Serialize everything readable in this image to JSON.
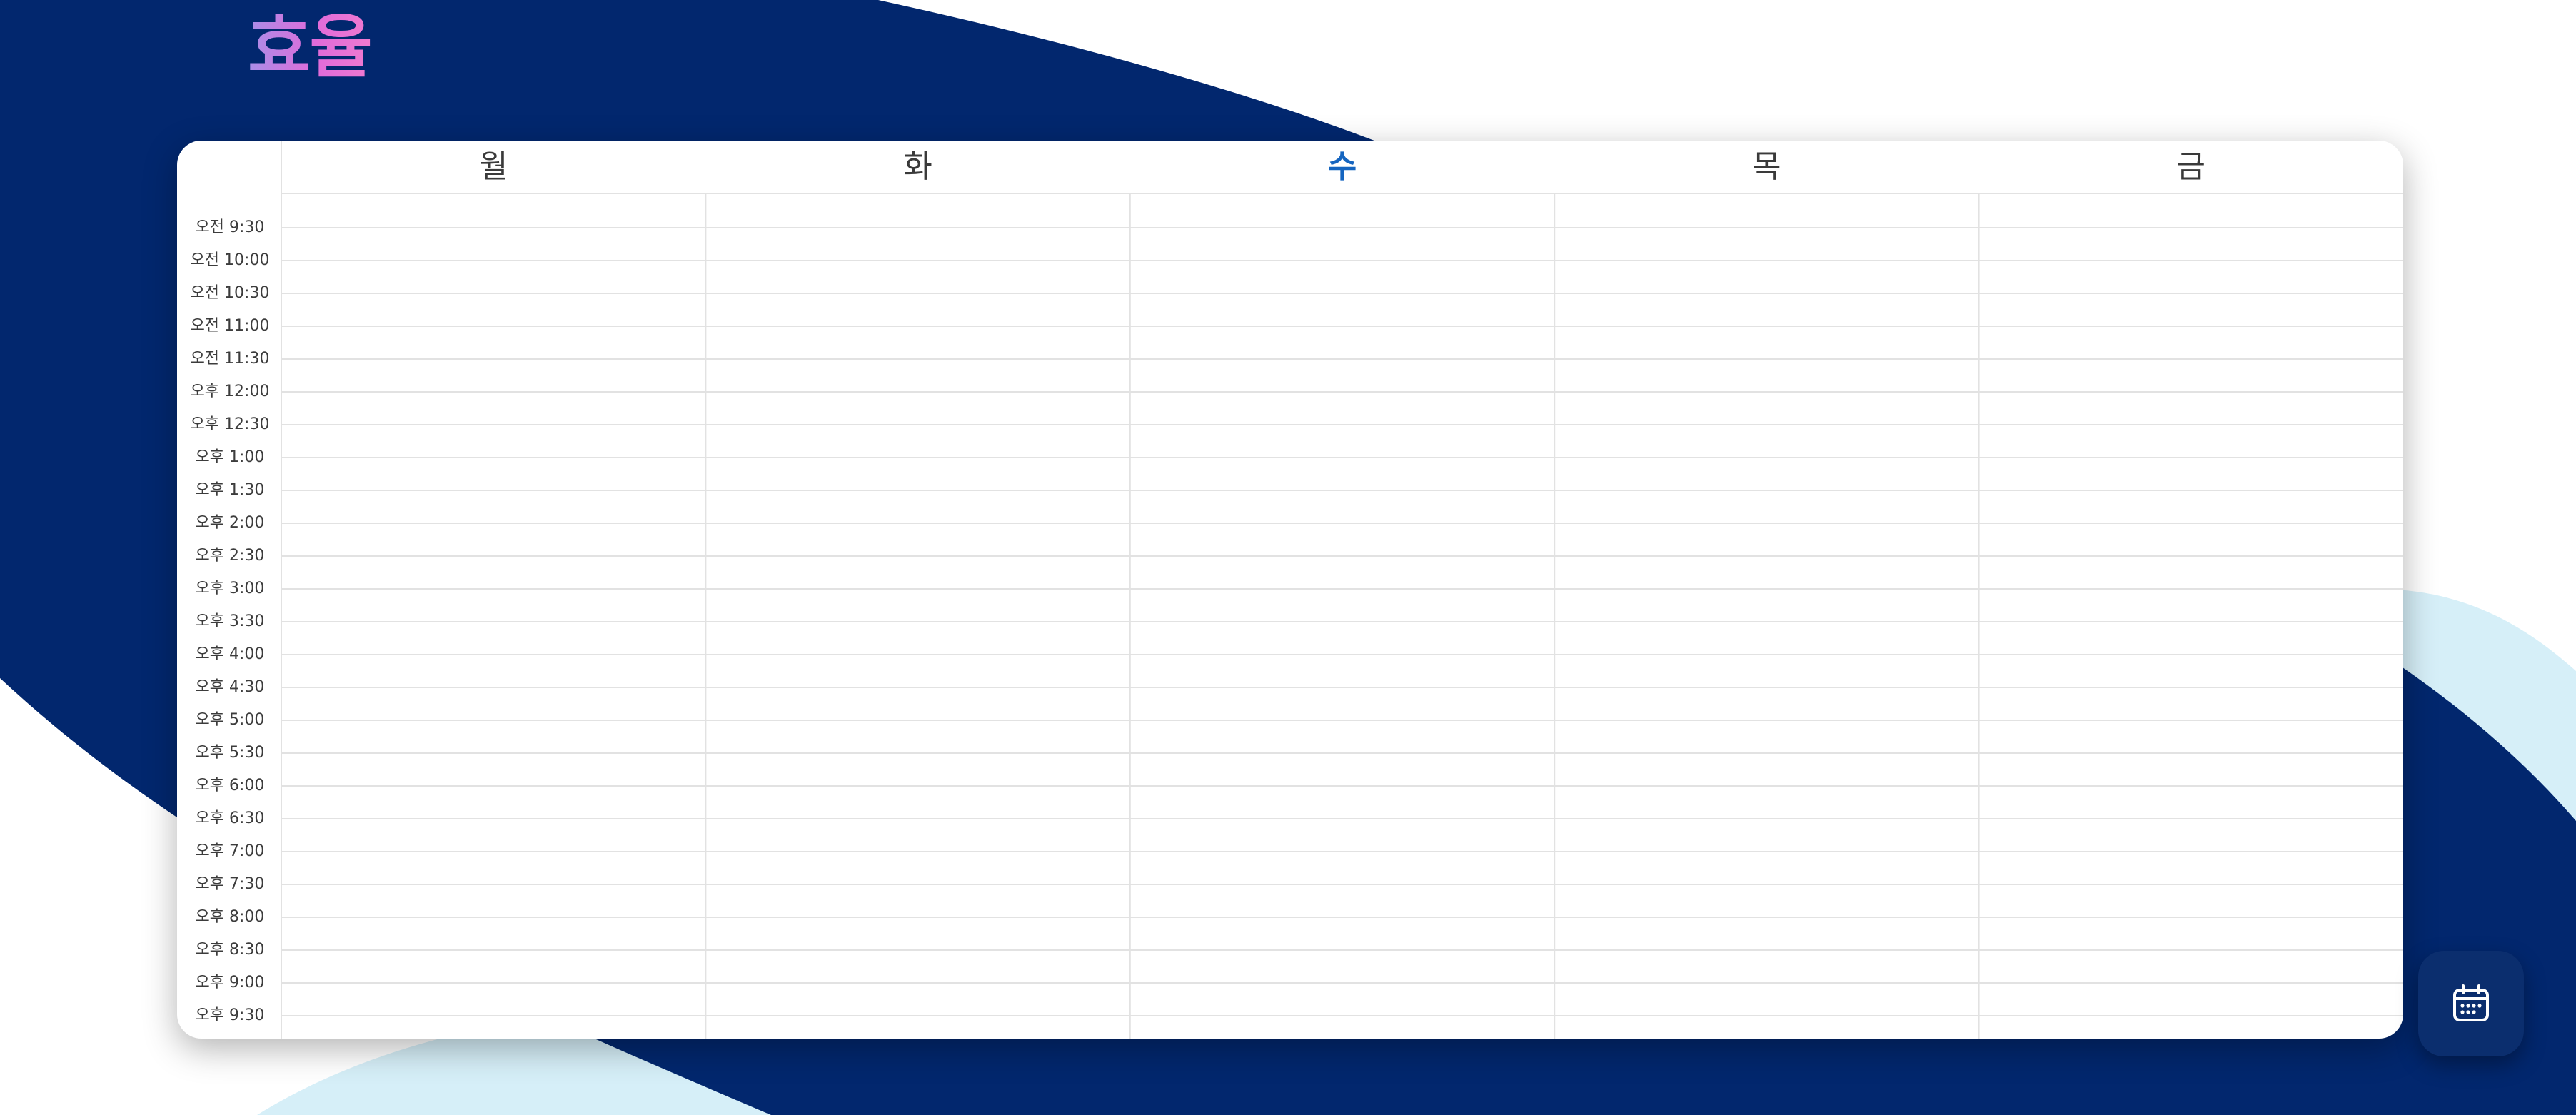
{
  "app": {
    "logo_text": "효율"
  },
  "timetable": {
    "days": [
      {
        "label": "월",
        "today": false
      },
      {
        "label": "화",
        "today": false
      },
      {
        "label": "수",
        "today": true
      },
      {
        "label": "목",
        "today": false
      },
      {
        "label": "금",
        "today": false
      }
    ],
    "times": [
      "오전 9:30",
      "오전 10:00",
      "오전 10:30",
      "오전 11:00",
      "오전 11:30",
      "오후 12:00",
      "오후 12:30",
      "오후 1:00",
      "오후 1:30",
      "오후 2:00",
      "오후 2:30",
      "오후 3:00",
      "오후 3:30",
      "오후 4:00",
      "오후 4:30",
      "오후 5:00",
      "오후 5:30",
      "오후 6:00",
      "오후 6:30",
      "오후 7:00",
      "오후 7:30",
      "오후 8:00",
      "오후 8:30",
      "오후 9:00",
      "오후 9:30"
    ]
  },
  "fab": {
    "icon": "calendar-icon"
  },
  "colors": {
    "navy": "#02276e",
    "light_blue": "#d6eff8",
    "today_accent": "#1565c0",
    "logo_gradient_start": "#a98ee8",
    "logo_gradient_end": "#f07ad0"
  }
}
